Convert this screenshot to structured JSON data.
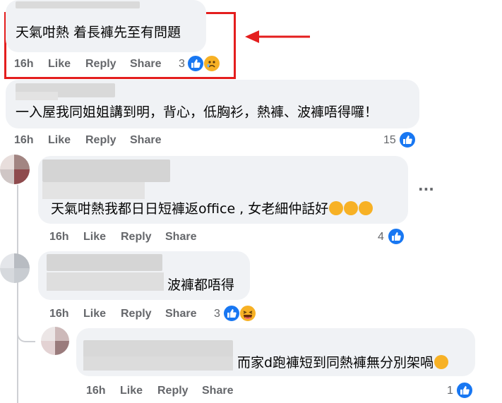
{
  "comments": [
    {
      "text": "天氣咁熱 着長褲先至有問題",
      "time": "16h",
      "like": "Like",
      "reply": "Reply",
      "share": "Share",
      "reaction_count": "3"
    },
    {
      "text": "一入屋我同姐姐講到明，背心，低胸衫，熱褲、波褲唔得囉！",
      "time": "16h",
      "like": "Like",
      "reply": "Reply",
      "share": "Share",
      "reaction_count": "15"
    },
    {
      "text": "天氣咁熱我都日日短褲返office , 女老細仲話好",
      "time": "16h",
      "like": "Like",
      "reply": "Reply",
      "share": "Share",
      "reaction_count": "4",
      "more": "···"
    },
    {
      "text": "波褲都唔得",
      "time": "16h",
      "like": "Like",
      "reply": "Reply",
      "share": "Share",
      "reaction_count": "3"
    },
    {
      "text": "而家d跑褲短到同熱褲無分別架喎",
      "time": "16h",
      "like": "Like",
      "reply": "Reply",
      "share": "Share",
      "reaction_count": "1"
    }
  ],
  "colors": {
    "accent": "#1877f2",
    "highlight": "#e41e1e",
    "bubble": "#f0f2f5",
    "meta": "#65676b"
  }
}
